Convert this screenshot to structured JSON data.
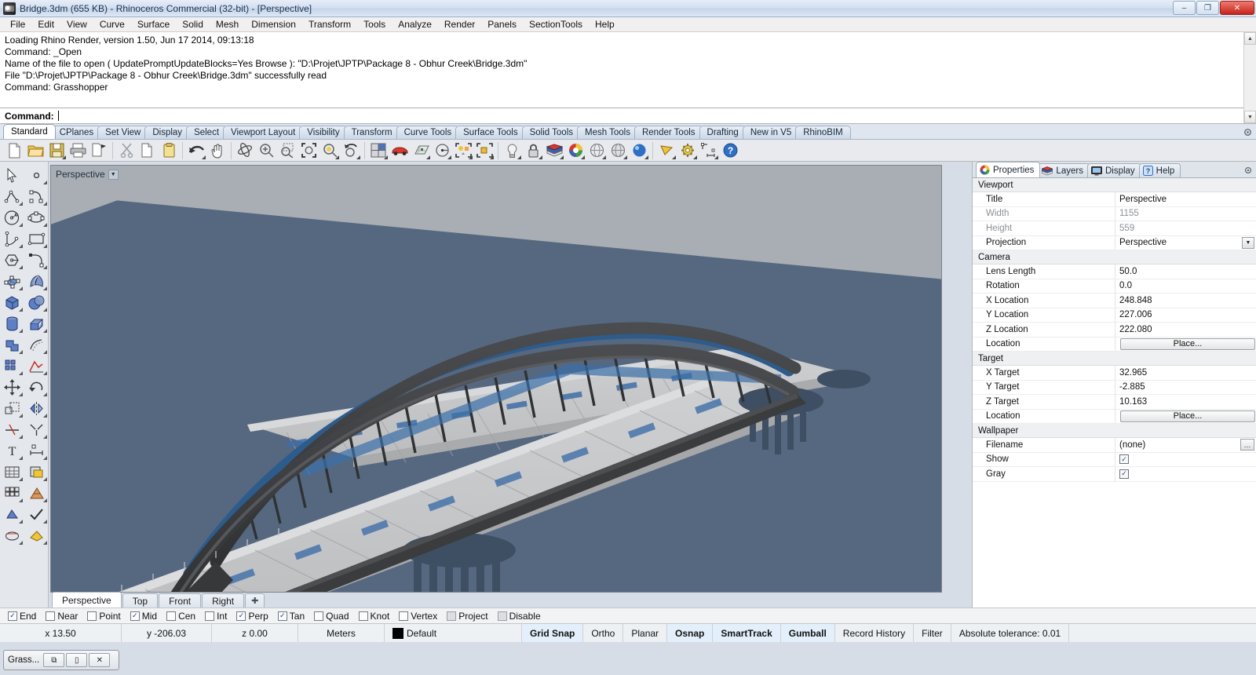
{
  "window": {
    "title": "Bridge.3dm (655 KB) - Rhinoceros Commercial (32-bit) - [Perspective]",
    "app_icon": "rhino-icon",
    "minimize": "–",
    "maximize": "❐",
    "close": "✕"
  },
  "menu": {
    "items": [
      {
        "label": "File"
      },
      {
        "label": "Edit"
      },
      {
        "label": "View"
      },
      {
        "label": "Curve"
      },
      {
        "label": "Surface"
      },
      {
        "label": "Solid"
      },
      {
        "label": "Mesh"
      },
      {
        "label": "Dimension"
      },
      {
        "label": "Transform"
      },
      {
        "label": "Tools"
      },
      {
        "label": "Analyze"
      },
      {
        "label": "Render"
      },
      {
        "label": "Panels"
      },
      {
        "label": "SectionTools"
      },
      {
        "label": "Help"
      }
    ]
  },
  "command_area": {
    "history": [
      "Loading Rhino Render, version 1.50, Jun 17 2014, 09:13:18",
      "Command: _Open",
      "Name of the file to open ( UpdatePromptUpdateBlocks=Yes  Browse ): \"D:\\Projet\\JPTP\\Package 8 - Obhur Creek\\Bridge.3dm\"",
      "File \"D:\\Projet\\JPTP\\Package 8 - Obhur Creek\\Bridge.3dm\" successfully read",
      "Command: Grasshopper"
    ],
    "prompt_label": "Command:",
    "prompt_value": "",
    "scroll_up": "▲",
    "scroll_down": "▼"
  },
  "toolbar_tabs": {
    "items": [
      {
        "label": "Standard",
        "active": true
      },
      {
        "label": "CPlanes",
        "active": false
      },
      {
        "label": "Set View",
        "active": false
      },
      {
        "label": "Display",
        "active": false
      },
      {
        "label": "Select",
        "active": false
      },
      {
        "label": "Viewport Layout",
        "active": false
      },
      {
        "label": "Visibility",
        "active": false
      },
      {
        "label": "Transform",
        "active": false
      },
      {
        "label": "Curve Tools",
        "active": false
      },
      {
        "label": "Surface Tools",
        "active": false
      },
      {
        "label": "Solid Tools",
        "active": false
      },
      {
        "label": "Mesh Tools",
        "active": false
      },
      {
        "label": "Render Tools",
        "active": false
      },
      {
        "label": "Drafting",
        "active": false
      },
      {
        "label": "New in V5",
        "active": false
      },
      {
        "label": "RhinoBIM",
        "active": false
      }
    ],
    "options_icon": "gear-icon"
  },
  "main_toolbar": {
    "icons": [
      "new-file-icon",
      "open-folder-icon",
      "save-icon",
      "print-icon",
      "copy-to-clipboard-icon",
      "cut-icon",
      "copy-icon",
      "paste-icon",
      "undo-icon",
      "pan-icon",
      "rotate-view-icon",
      "zoom-in-icon",
      "zoom-window-icon",
      "zoom-extents-icon",
      "zoom-selected-icon",
      "zoom-previous-icon",
      "viewport-layout-icon",
      "car-icon",
      "cplane-icon",
      "circle-radius-icon",
      "select-objects-icon",
      "group-icon",
      "light-bulb-icon",
      "lock-icon",
      "layers-icon",
      "color-wheel-icon",
      "shade-icon",
      "render-mesh-icon",
      "render-icon",
      "camera-icon",
      "options-gear-icon",
      "dimension-icon",
      "help-icon"
    ]
  },
  "side_toolbar": {
    "icons": [
      "select-arrow-icon",
      "point-icon",
      "polyline-icon",
      "curve-icon",
      "circle-icon",
      "ellipse-icon",
      "arc-icon",
      "rectangle-icon",
      "polygon-icon",
      "fillet-curve-icon",
      "surface-srf-pt-icon",
      "surface-loft-icon",
      "box-icon",
      "sphere-icon",
      "cylinder-icon",
      "extrude-icon",
      "boolean-union-icon",
      "offset-icon",
      "array-icon",
      "analyze-icon",
      "move-icon",
      "rotate-icon",
      "scale-icon",
      "mirror-icon",
      "trim-icon",
      "split-icon",
      "text-icon",
      "dim-icon",
      "hatch-icon",
      "block-icon",
      "mesh-icon",
      "mesh-tools-icon",
      "render-material-icon",
      "check-icon",
      "section-icon",
      "layer-state-icon"
    ]
  },
  "viewport": {
    "label": "Perspective",
    "dropdown_icon": "chevron-down-icon",
    "colors": {
      "background": "#a8aeb4",
      "water": "#566880",
      "deck": "#c8c9cb",
      "arch_dark": "#3a3c3e",
      "accent_blue": "#2d5c8c",
      "pier": "#4e6175"
    },
    "tabs": [
      {
        "label": "Perspective",
        "active": true
      },
      {
        "label": "Top",
        "active": false
      },
      {
        "label": "Front",
        "active": false
      },
      {
        "label": "Right",
        "active": false
      },
      {
        "label": "✚",
        "active": false
      }
    ]
  },
  "right_panel": {
    "tabs": [
      {
        "label": "Properties",
        "icon": "properties-icon",
        "active": true
      },
      {
        "label": "Layers",
        "icon": "layers-icon",
        "active": false
      },
      {
        "label": "Display",
        "icon": "display-monitor-icon",
        "active": false
      },
      {
        "label": "Help",
        "icon": "help-question-icon",
        "active": false
      }
    ],
    "options_icon": "panel-gear-icon",
    "sections": [
      {
        "title": "Viewport",
        "rows": [
          {
            "key": "Title",
            "value": "Perspective",
            "type": "text",
            "dim": false
          },
          {
            "key": "Width",
            "value": "1155",
            "type": "text",
            "dim": true
          },
          {
            "key": "Height",
            "value": "559",
            "type": "text",
            "dim": true
          },
          {
            "key": "Projection",
            "value": "Perspective",
            "type": "dropdown",
            "dim": false
          }
        ]
      },
      {
        "title": "Camera",
        "rows": [
          {
            "key": "Lens Length",
            "value": "50.0",
            "type": "text",
            "dim": false
          },
          {
            "key": "Rotation",
            "value": "0.0",
            "type": "text",
            "dim": false
          },
          {
            "key": "X Location",
            "value": "248.848",
            "type": "text",
            "dim": false
          },
          {
            "key": "Y Location",
            "value": "227.006",
            "type": "text",
            "dim": false
          },
          {
            "key": "Z Location",
            "value": "222.080",
            "type": "text",
            "dim": false
          },
          {
            "key": "Location",
            "value": "Place...",
            "type": "button",
            "dim": false
          }
        ]
      },
      {
        "title": "Target",
        "rows": [
          {
            "key": "X Target",
            "value": "32.965",
            "type": "text",
            "dim": false
          },
          {
            "key": "Y Target",
            "value": "-2.885",
            "type": "text",
            "dim": false
          },
          {
            "key": "Z Target",
            "value": "10.163",
            "type": "text",
            "dim": false
          },
          {
            "key": "Location",
            "value": "Place...",
            "type": "button",
            "dim": false
          }
        ]
      },
      {
        "title": "Wallpaper",
        "rows": [
          {
            "key": "Filename",
            "value": "(none)",
            "type": "ellipsis",
            "dim": false
          },
          {
            "key": "Show",
            "value": "",
            "type": "checkbox",
            "checked": true,
            "dim": false
          },
          {
            "key": "Gray",
            "value": "",
            "type": "checkbox",
            "checked": true,
            "dim": false
          }
        ]
      }
    ]
  },
  "osnap": {
    "items": [
      {
        "label": "End",
        "checked": true,
        "enabled": true
      },
      {
        "label": "Near",
        "checked": false,
        "enabled": true
      },
      {
        "label": "Point",
        "checked": false,
        "enabled": true
      },
      {
        "label": "Mid",
        "checked": true,
        "enabled": true
      },
      {
        "label": "Cen",
        "checked": false,
        "enabled": true
      },
      {
        "label": "Int",
        "checked": false,
        "enabled": true
      },
      {
        "label": "Perp",
        "checked": true,
        "enabled": true
      },
      {
        "label": "Tan",
        "checked": true,
        "enabled": true
      },
      {
        "label": "Quad",
        "checked": false,
        "enabled": true
      },
      {
        "label": "Knot",
        "checked": false,
        "enabled": true
      },
      {
        "label": "Vertex",
        "checked": false,
        "enabled": true
      },
      {
        "label": "Project",
        "checked": false,
        "enabled": false
      },
      {
        "label": "Disable",
        "checked": false,
        "enabled": false
      }
    ]
  },
  "statusbar": {
    "x": "x 13.50",
    "y": "y -206.03",
    "z": "z 0.00",
    "units": "Meters",
    "layer": "Default",
    "layer_color": "#000000",
    "toggles": [
      {
        "label": "Grid Snap",
        "on": true
      },
      {
        "label": "Ortho",
        "on": false
      },
      {
        "label": "Planar",
        "on": false
      },
      {
        "label": "Osnap",
        "on": true
      },
      {
        "label": "SmartTrack",
        "on": true
      },
      {
        "label": "Gumball",
        "on": true
      },
      {
        "label": "Record History",
        "on": false
      },
      {
        "label": "Filter",
        "on": false
      }
    ],
    "tolerance": "Absolute tolerance: 0.01"
  },
  "grasshopper_window": {
    "label": "Grass...",
    "restore_icon": "restore-icon",
    "minimize_icon": "minimize-icon",
    "close_icon": "close-icon"
  }
}
